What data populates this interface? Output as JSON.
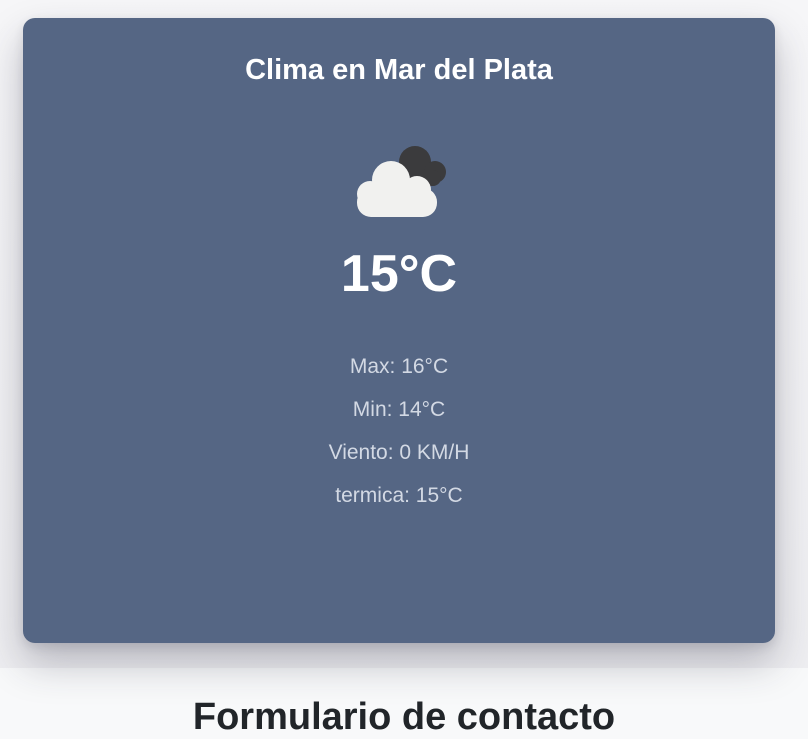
{
  "weather": {
    "title": "Clima en Mar del Plata",
    "icon": "cloudy-icon",
    "temperature": "15°C",
    "max": "Max: 16°C",
    "min": "Min: 14°C",
    "wind": "Viento: 0 KM/H",
    "feels_like": "termica: 15°C"
  },
  "contact": {
    "title": "Formulario de contacto"
  },
  "colors": {
    "card_background": "#556684",
    "page_background": "#f8f9fa",
    "detail_text": "#d3d9e4"
  }
}
